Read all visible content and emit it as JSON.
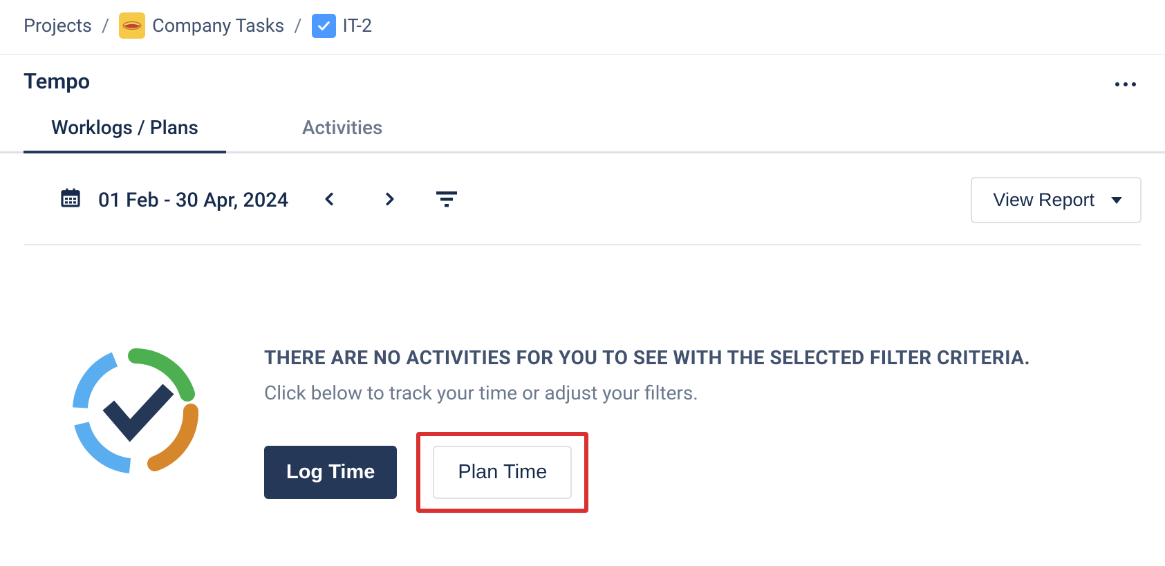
{
  "breadcrumb": {
    "projects_label": "Projects",
    "project_name": "Company Tasks",
    "issue_key": "IT-2"
  },
  "panel": {
    "title": "Tempo"
  },
  "tabs": {
    "worklogs_plans": "Worklogs / Plans",
    "activities": "Activities"
  },
  "toolbar": {
    "date_range": "01 Feb - 30 Apr, 2024",
    "view_report_label": "View Report"
  },
  "empty": {
    "heading": "THERE ARE NO ACTIVITIES FOR YOU TO SEE WITH THE SELECTED FILTER CRITERIA.",
    "subtext": "Click below to track your time or adjust your filters.",
    "log_time_label": "Log Time",
    "plan_time_label": "Plan Time"
  },
  "colors": {
    "primary_button": "#253858",
    "highlight_border": "#d93030",
    "ring_green": "#4caf50",
    "ring_blue": "#5aaef0",
    "ring_orange": "#d6862b",
    "check_navy": "#253858"
  }
}
